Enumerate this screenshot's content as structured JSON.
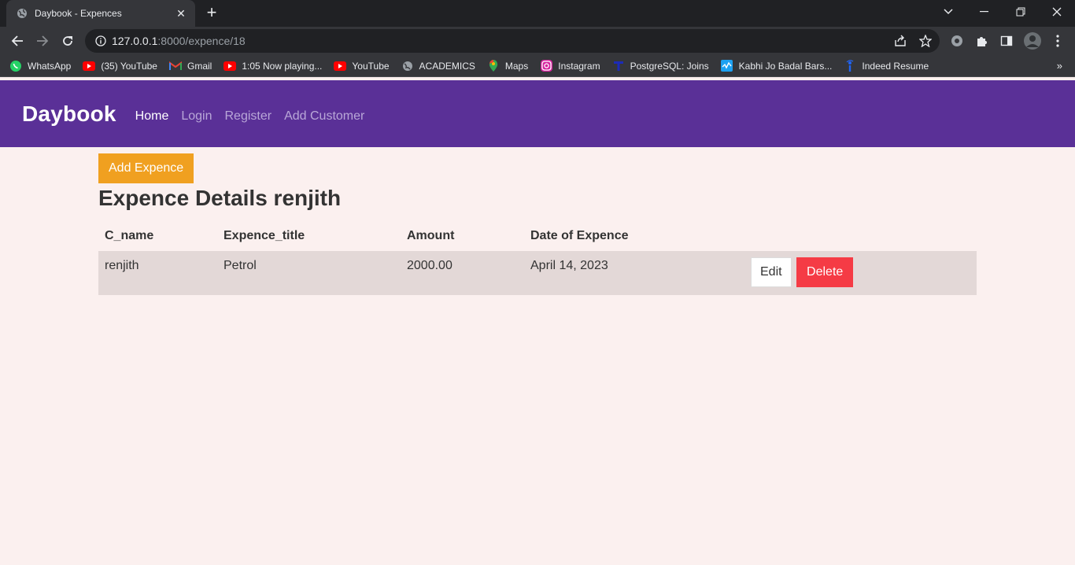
{
  "browser": {
    "tab_title": "Daybook - Expences",
    "url_host": "127.0.0.1",
    "url_path": ":8000/expence/18",
    "bookmarks": [
      {
        "label": "WhatsApp",
        "icon": "whatsapp-icon"
      },
      {
        "label": "(35) YouTube",
        "icon": "youtube-icon"
      },
      {
        "label": "Gmail",
        "icon": "gmail-icon"
      },
      {
        "label": "1:05 Now playing...",
        "icon": "youtube-icon"
      },
      {
        "label": "YouTube",
        "icon": "youtube-icon"
      },
      {
        "label": "ACADEMICS",
        "icon": "globe-icon"
      },
      {
        "label": "Maps",
        "icon": "maps-icon"
      },
      {
        "label": "Instagram",
        "icon": "instagram-icon"
      },
      {
        "label": "PostgreSQL: Joins",
        "icon": "postgresql-icon"
      },
      {
        "label": "Kabhi Jo Badal Bars...",
        "icon": "music-icon"
      },
      {
        "label": "Indeed Resume",
        "icon": "indeed-icon"
      }
    ]
  },
  "navbar": {
    "brand": "Daybook",
    "links": [
      "Home",
      "Login",
      "Register",
      "Add Customer"
    ]
  },
  "main": {
    "add_button": "Add Expence",
    "heading": "Expence Details renjith",
    "columns": [
      "C_name",
      "Expence_title",
      "Amount",
      "Date of Expence"
    ],
    "rows": [
      {
        "c_name": "renjith",
        "title": "Petrol",
        "amount": "2000.00",
        "date": "April 14, 2023"
      }
    ],
    "edit_label": "Edit",
    "delete_label": "Delete"
  },
  "colors": {
    "navbar": "#5a3097",
    "add_button": "#f0a020",
    "delete_button": "#f53b45",
    "page_bg": "#fbf0ef",
    "row_bg": "#e3d8d7"
  }
}
